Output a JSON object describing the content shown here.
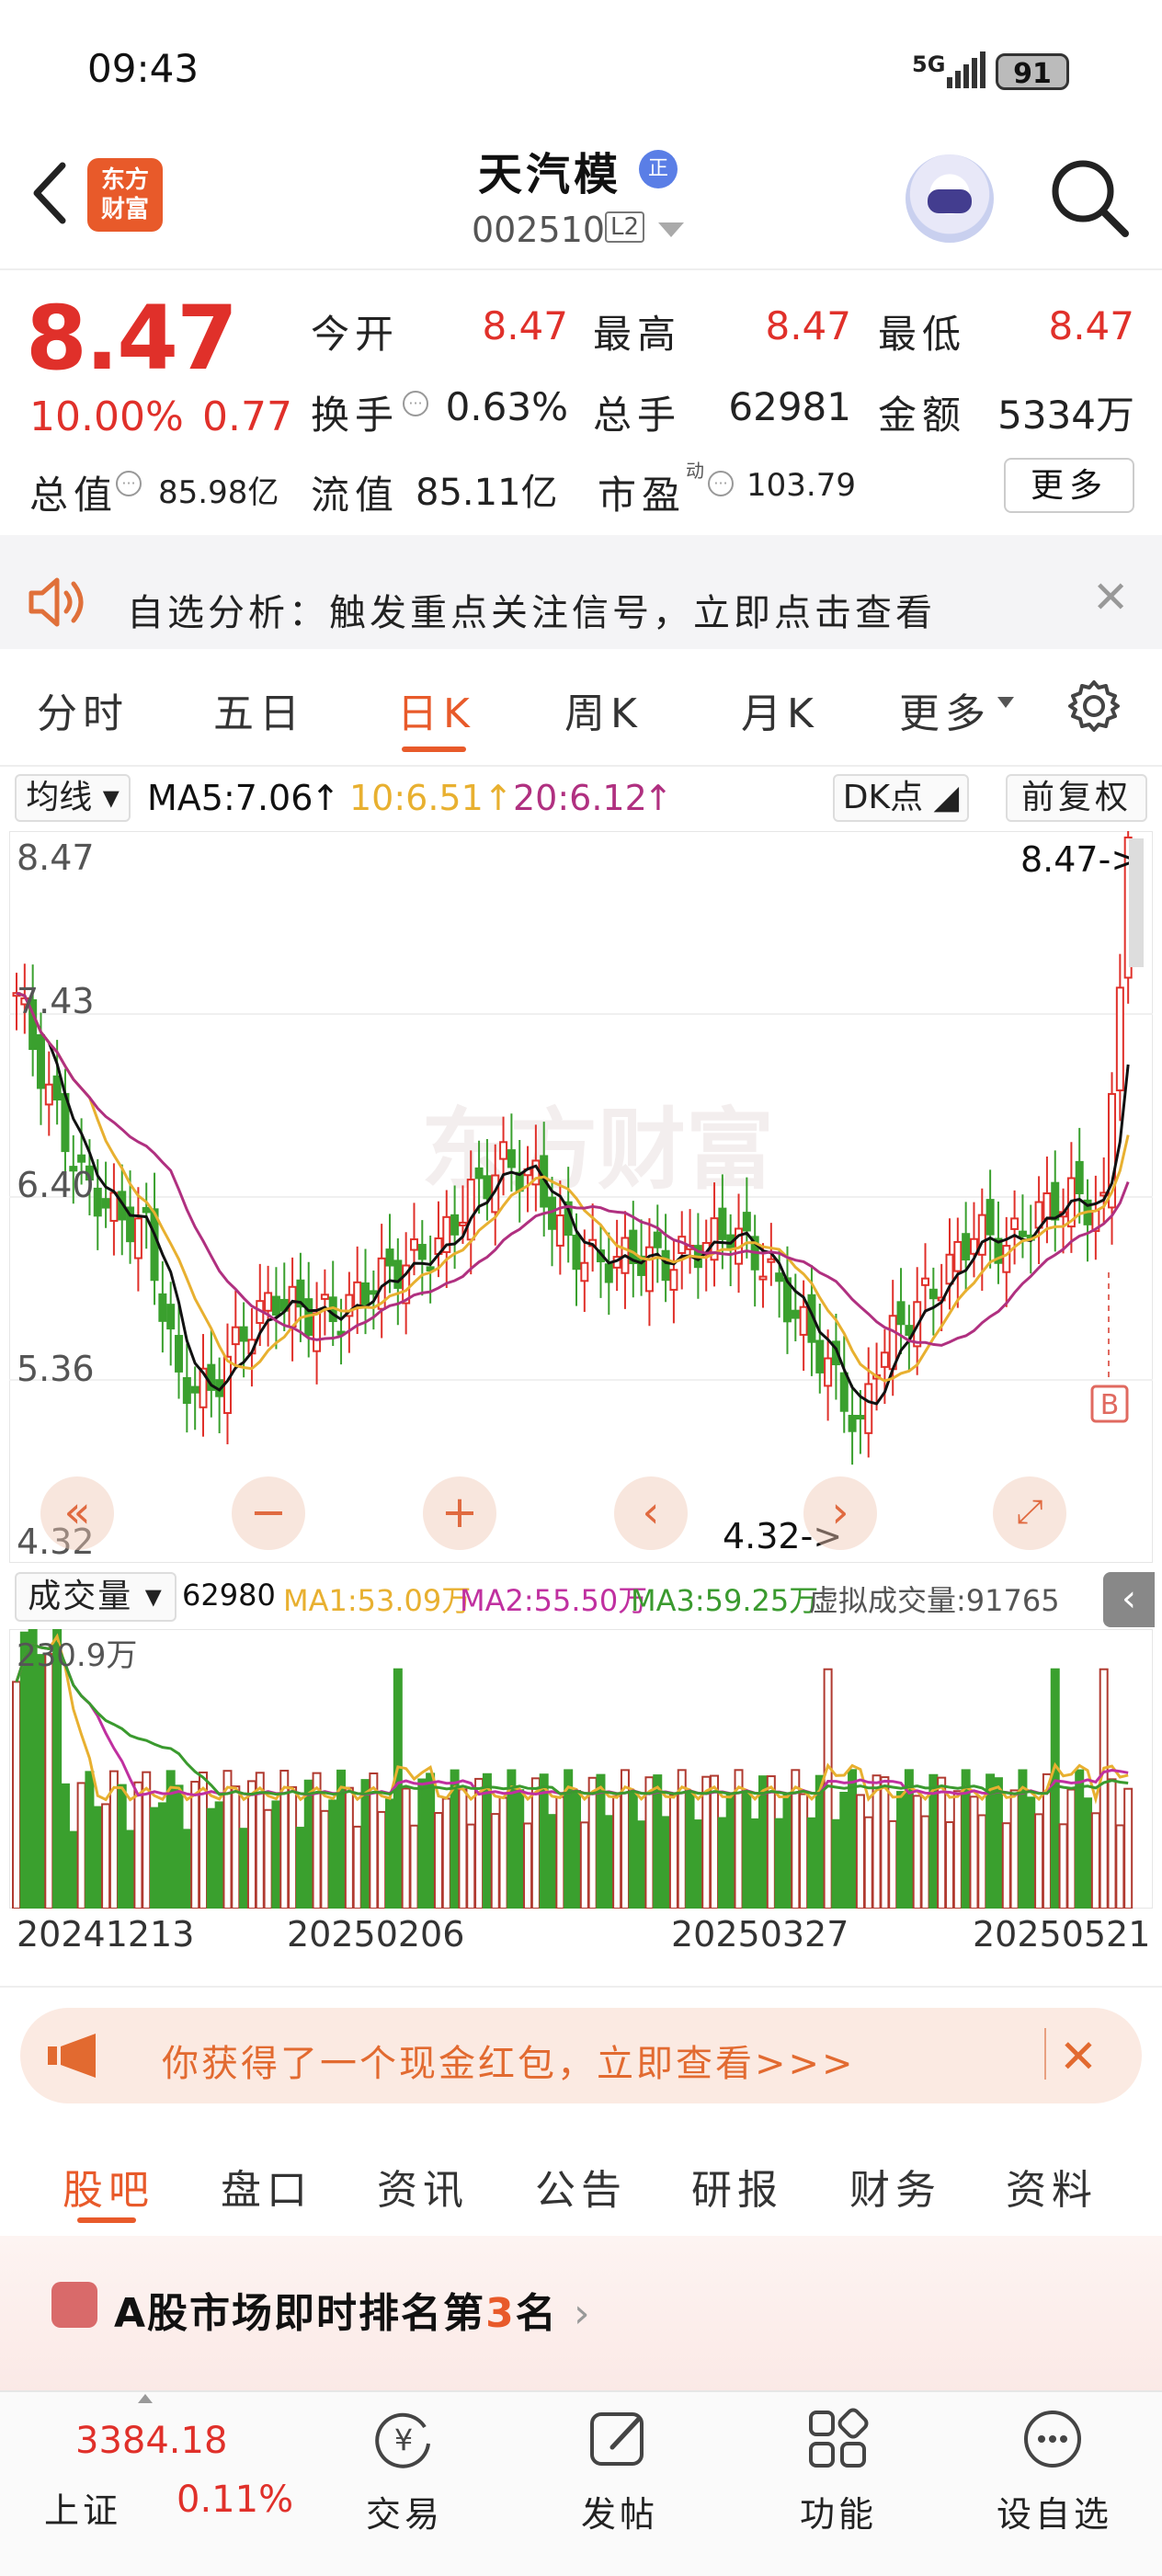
{
  "status": {
    "time": "09:43",
    "network": "5G",
    "battery": "91"
  },
  "header": {
    "logo_line1": "东方",
    "logo_line2": "财富",
    "stock_name": "天汽模",
    "badge": "正",
    "code": "002510",
    "level": "L2"
  },
  "quote": {
    "price": "8.47",
    "change_pct": "10.00%",
    "change_amt": "0.77",
    "open_label": "今开",
    "open": "8.47",
    "high_label": "最高",
    "high": "8.47",
    "low_label": "最低",
    "low": "8.47",
    "turnover_label": "换手",
    "turnover": "0.63%",
    "volume_label": "总手",
    "volume": "62981",
    "amount_label": "金额",
    "amount": "5334万",
    "mktcap_label": "总值",
    "mktcap": "85.98亿",
    "float_label": "流值",
    "float": "85.11亿",
    "pe_label": "市盈",
    "pe_sup": "动",
    "pe": "103.79",
    "more": "更多"
  },
  "banner": {
    "text": "自选分析：触发重点关注信号，立即点击查看"
  },
  "period_tabs": [
    "分时",
    "五日",
    "日K",
    "周K",
    "月K",
    "更多"
  ],
  "active_period": "日K",
  "ma": {
    "selector": "均线",
    "ma5": "MA5:7.06",
    "ma10": "10:6.51",
    "ma20": "20:6.12",
    "dk": "DK点",
    "adjust": "前复权"
  },
  "kchart": {
    "max_label": "8.47",
    "min_label": "4.32",
    "y_labels": [
      "8.47",
      "7.43",
      "6.40",
      "5.36",
      "4.32"
    ],
    "high_marker": "8.47->",
    "low_marker": "4.32->",
    "signal": "B",
    "watermark": "东方财富"
  },
  "volume": {
    "selector": "成交量",
    "value": "62980",
    "ma1": "MA1:53.09万",
    "ma2": "MA2:55.50万",
    "ma3": "MA3:59.25万",
    "virtual": "虚拟成交量:91765",
    "max_label": "230.9万"
  },
  "dates": [
    "20241213",
    "20250206",
    "20250327",
    "20250521"
  ],
  "colors": {
    "up": "#e0302a",
    "down": "#3aa02e",
    "ma5": "#111111",
    "ma10": "#e8b030",
    "ma20": "#b03080",
    "accent": "#e85a2a"
  },
  "packet": {
    "text": "你获得了一个现金红包，立即查看>>>"
  },
  "bottom_tabs": [
    "股吧",
    "盘口",
    "资讯",
    "公告",
    "研报",
    "财务",
    "资料"
  ],
  "rank": {
    "prefix": "A股市场即时排名第",
    "num": "3",
    "suffix": "名"
  },
  "footer": {
    "index_value": "3384.18",
    "index_name": "上证",
    "index_change": "0.11%",
    "trade": "交易",
    "post": "发帖",
    "func": "功能",
    "watch": "设自选"
  }
}
